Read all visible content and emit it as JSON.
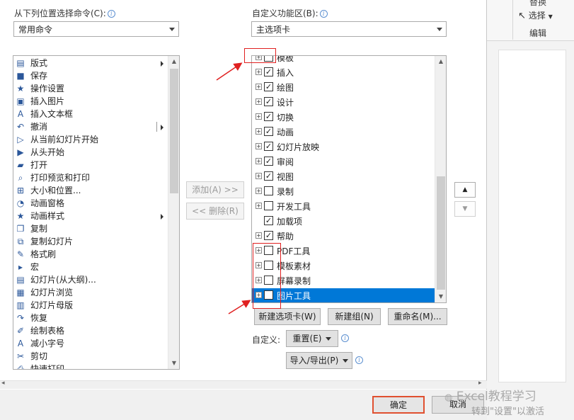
{
  "left_panel": {
    "label": "从下列位置选择命令(C):",
    "dropdown_value": "常用命令",
    "commands": [
      {
        "label": "版式",
        "icon": "layout-icon",
        "has_submenu": true
      },
      {
        "label": "保存",
        "icon": "save-icon"
      },
      {
        "label": "操作设置",
        "icon": "action-settings-icon"
      },
      {
        "label": "插入图片",
        "icon": "insert-picture-icon"
      },
      {
        "label": "插入文本框",
        "icon": "insert-textbox-icon"
      },
      {
        "label": "撤消",
        "icon": "undo-icon",
        "has_split": true
      },
      {
        "label": "从当前幻灯片开始",
        "icon": "from-current-slide-icon"
      },
      {
        "label": "从头开始",
        "icon": "from-beginning-icon"
      },
      {
        "label": "打开",
        "icon": "open-folder-icon"
      },
      {
        "label": "打印预览和打印",
        "icon": "print-preview-icon"
      },
      {
        "label": "大小和位置...",
        "icon": "size-position-icon"
      },
      {
        "label": "动画窗格",
        "icon": "animation-pane-icon"
      },
      {
        "label": "动画样式",
        "icon": "animation-style-icon",
        "has_submenu": true
      },
      {
        "label": "复制",
        "icon": "copy-icon"
      },
      {
        "label": "复制幻灯片",
        "icon": "duplicate-slide-icon"
      },
      {
        "label": "格式刷",
        "icon": "format-painter-icon"
      },
      {
        "label": "宏",
        "icon": "macro-icon"
      },
      {
        "label": "幻灯片(从大纲)...",
        "icon": "slides-from-outline-icon"
      },
      {
        "label": "幻灯片浏览",
        "icon": "slide-sorter-icon"
      },
      {
        "label": "幻灯片母版",
        "icon": "slide-master-icon"
      },
      {
        "label": "恢复",
        "icon": "redo-icon"
      },
      {
        "label": "绘制表格",
        "icon": "draw-table-icon"
      },
      {
        "label": "减小字号",
        "icon": "decrease-font-icon"
      },
      {
        "label": "剪切",
        "icon": "cut-icon"
      },
      {
        "label": "快速打印",
        "icon": "quick-print-icon"
      }
    ]
  },
  "middle": {
    "add_label": "添加(A) >>",
    "remove_label": "<< 删除(R)"
  },
  "right_panel": {
    "label": "自定义功能区(B):",
    "dropdown_value": "主选项卡",
    "tabs": [
      {
        "label": "模板",
        "checked": false,
        "partial": true
      },
      {
        "label": "插入",
        "checked": true
      },
      {
        "label": "绘图",
        "checked": true
      },
      {
        "label": "设计",
        "checked": true
      },
      {
        "label": "切换",
        "checked": true
      },
      {
        "label": "动画",
        "checked": true
      },
      {
        "label": "幻灯片放映",
        "checked": true
      },
      {
        "label": "审阅",
        "checked": true
      },
      {
        "label": "视图",
        "checked": true
      },
      {
        "label": "录制",
        "checked": false
      },
      {
        "label": "开发工具",
        "checked": false
      },
      {
        "label": "加载项",
        "checked": true,
        "no_expander": true
      },
      {
        "label": "帮助",
        "checked": true
      },
      {
        "label": "PDF工具",
        "checked": false
      },
      {
        "label": "模板素材",
        "checked": false
      },
      {
        "label": "屏幕录制",
        "checked": false
      },
      {
        "label": "图片工具",
        "checked": false,
        "selected": true
      }
    ],
    "new_tab_label": "新建选项卡(W)",
    "new_group_label": "新建组(N)",
    "rename_label": "重命名(M)...",
    "customize_label": "自定义:",
    "reset_label": "重置(E)",
    "import_export_label": "导入/导出(P)"
  },
  "footer": {
    "ok_label": "确定",
    "cancel_label": "取消"
  },
  "background": {
    "select_label": "选择",
    "edit_group_label": "编辑",
    "replace_label": "替换",
    "watermark": "Excel教程学习",
    "activation_text": "转到\"设置\"以激活"
  },
  "colors": {
    "selection": "#0078d7",
    "annotation": "#e02020"
  }
}
